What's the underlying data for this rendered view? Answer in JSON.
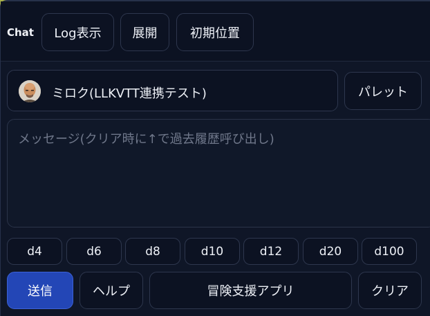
{
  "header": {
    "title": "Chat",
    "buttons": {
      "log": "Log表示",
      "expand": "展開",
      "reset": "初期位置"
    }
  },
  "character": {
    "name": "ミロク(LLKVTT連携テスト)",
    "palette": "パレット",
    "avatar_icon": "bald-man-avatar"
  },
  "message": {
    "placeholder": "メッセージ(クリア時に↑で過去履歴呼び出し)"
  },
  "dice": [
    "d4",
    "d6",
    "d8",
    "d10",
    "d12",
    "d20",
    "d100"
  ],
  "actions": {
    "send": "送信",
    "help": "ヘルプ",
    "app": "冒険支援アプリ",
    "clear": "クリア"
  },
  "colors": {
    "panel_bg": "#0f1627",
    "send_bg": "#2346b6",
    "background": "#a9b04a"
  }
}
